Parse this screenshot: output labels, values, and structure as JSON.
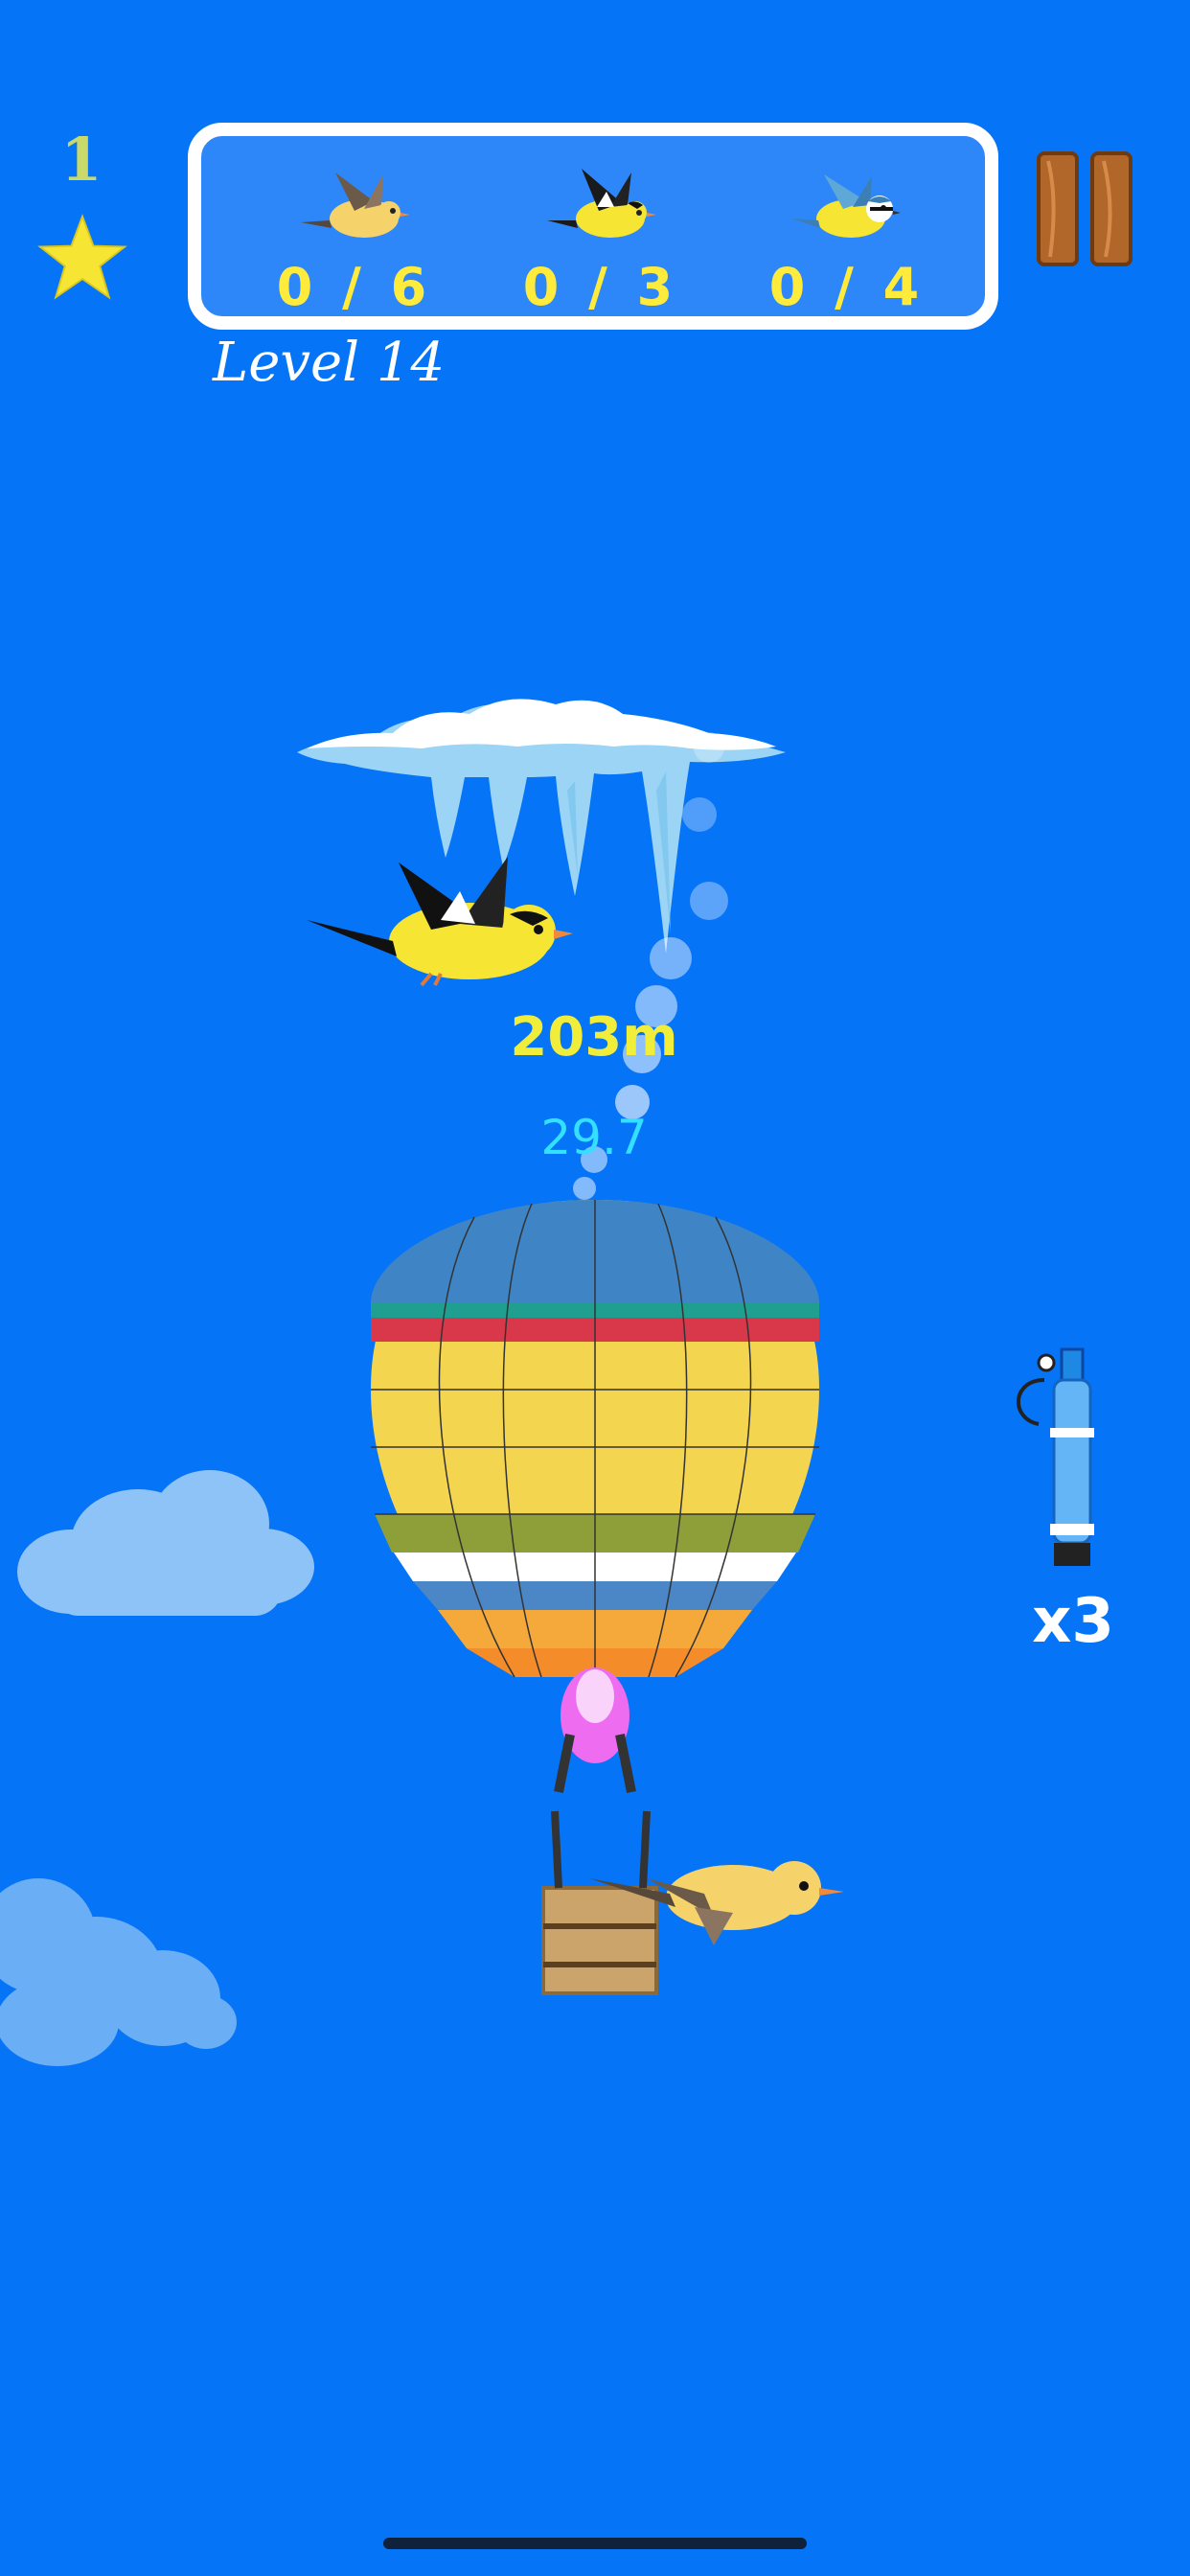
{
  "hud": {
    "star_count": "1",
    "level_label": "Level 14"
  },
  "goals": [
    {
      "bird": "sparrow-icon",
      "count": "0 / 6"
    },
    {
      "bird": "goldfinch-icon",
      "count": "0 / 3"
    },
    {
      "bird": "bluetit-icon",
      "count": "0 / 4"
    }
  ],
  "balloon": {
    "altitude": "203m",
    "speed": "29.7"
  },
  "powerup": {
    "icon": "gas-canister-icon",
    "multiplier": "x3"
  },
  "colors": {
    "sky": "#0574f6",
    "altitude_text": "#f1ee3b",
    "speed_text": "#33e0ff",
    "goal_count_text": "#ffeb3b"
  }
}
